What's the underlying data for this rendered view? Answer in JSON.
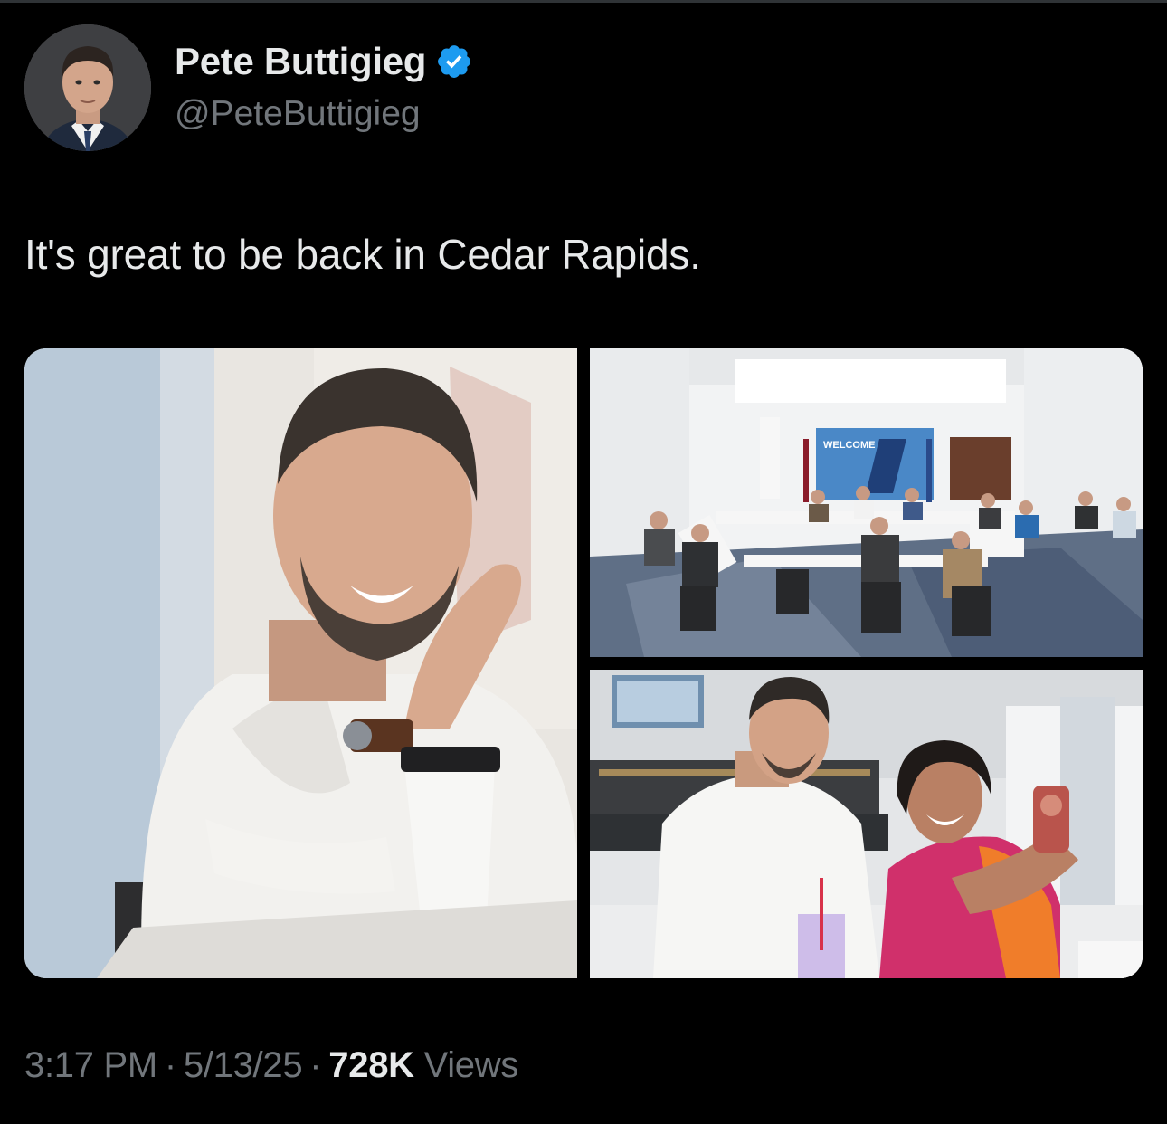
{
  "author": {
    "display_name": "Pete Buttigieg",
    "handle": "@PeteButtigieg",
    "verified": true,
    "verified_color": "#1d9bf0"
  },
  "tweet": {
    "text": "It's great to be back in Cedar Rapids.",
    "time": "3:17 PM",
    "date": "5/13/25",
    "separator": "·",
    "views_count": "728K",
    "views_label": "Views"
  },
  "media": {
    "count": 3,
    "sign_text": "WELCOME"
  },
  "colors": {
    "background": "#000000",
    "text_primary": "#e7e9ea",
    "text_secondary": "#71767b",
    "divider": "#2f3336"
  }
}
